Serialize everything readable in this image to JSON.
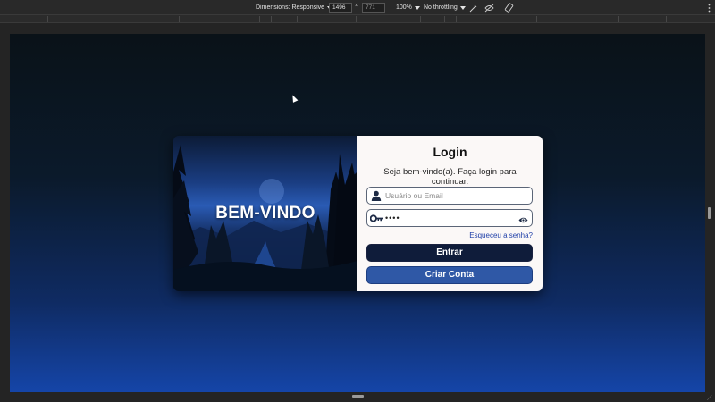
{
  "devtools": {
    "dimensions_label": "Dimensions: Responsive",
    "width_value": "1496",
    "height_value": "771",
    "times_sign": "×",
    "zoom": "100%",
    "throttling": "No throttling",
    "icons": [
      "no-touch-icon",
      "device-posture-icon",
      "rotate-icon",
      "more-options-icon"
    ]
  },
  "card": {
    "welcome_text": "BEM-VINDO",
    "login": {
      "title": "Login",
      "subtitle": "Seja bem-vindo(a). Faça login para continuar.",
      "username_placeholder": "Usuário ou Email",
      "password_value": "••••",
      "forgot_link": "Esqueceu a senha?",
      "enter_button": "Entrar",
      "create_button": "Criar Conta"
    }
  },
  "colors": {
    "enter_button_bg": "#0f1c3a",
    "create_button_bg": "#2f58a6",
    "link": "#1f3fa8",
    "form_bg": "#fbf8f7"
  }
}
